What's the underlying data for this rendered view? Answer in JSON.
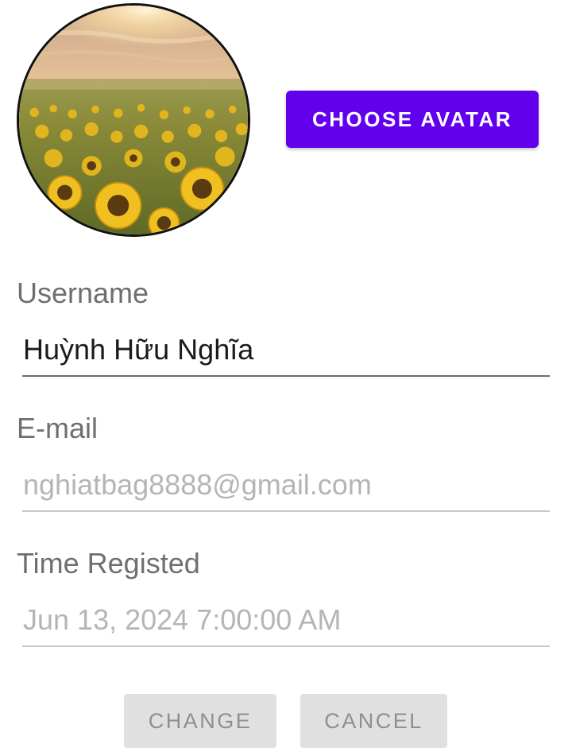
{
  "avatar": {
    "icon": "sunflower-field-photo"
  },
  "buttons": {
    "choose_avatar": "CHOOSE AVATAR",
    "change": "CHANGE",
    "cancel": "CANCEL"
  },
  "form": {
    "username": {
      "label": "Username",
      "value": "Huỳnh Hữu Nghĩa"
    },
    "email": {
      "label": "E-mail",
      "value": "nghiatbag8888@gmail.com"
    },
    "time_registered": {
      "label": "Time Registed",
      "value": "Jun 13, 2024 7:00:00 AM"
    }
  },
  "colors": {
    "accent": "#6200ee",
    "disabled_button_bg": "#e0e0e0",
    "disabled_text": "#b5b5b5",
    "label_text": "#6f6f6f"
  }
}
